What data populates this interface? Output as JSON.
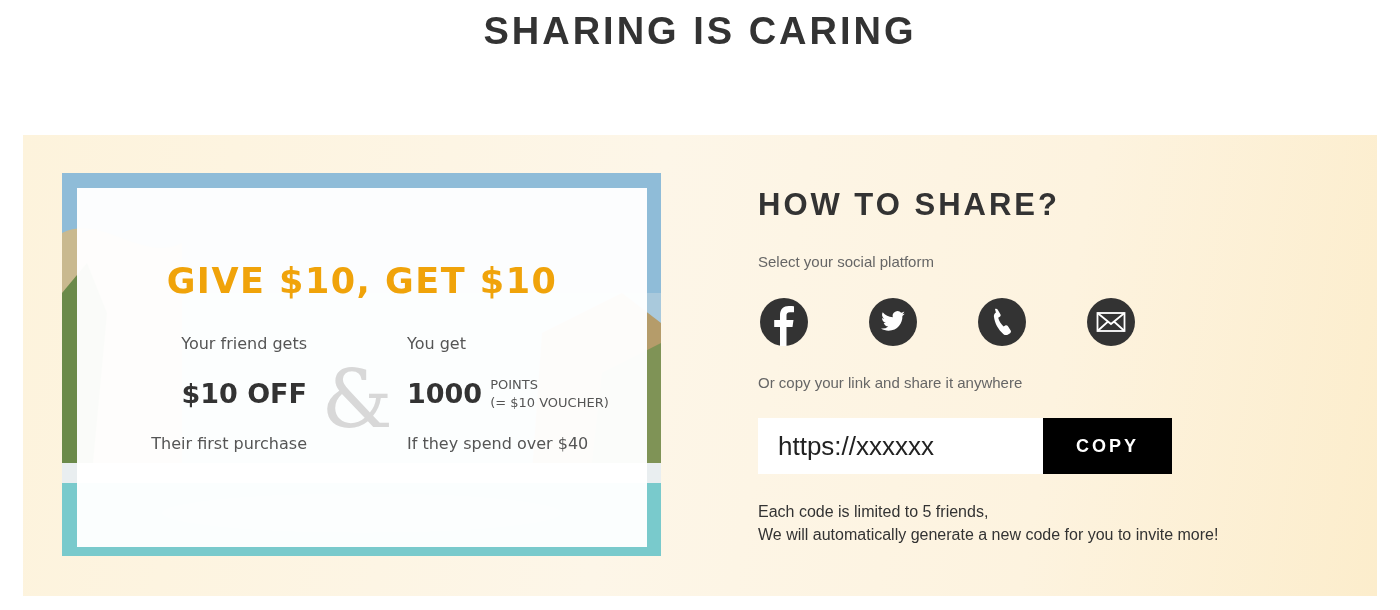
{
  "page_title": "SHARING IS CARING",
  "offer": {
    "kind": "picture",
    "headline": "GIVE $10, GET $10",
    "friend": {
      "label": "Your friend gets",
      "amount": "$10 OFF",
      "note": "Their first purchase"
    },
    "joiner": "&",
    "you": {
      "label": "You get",
      "amount": "1000",
      "unit": "POINTS",
      "unit_note": "(= $10 VOUCHER)",
      "note": "If they spend over $40"
    }
  },
  "share": {
    "heading": "HOW TO SHARE?",
    "platform_prompt": "Select your social platform",
    "platforms": [
      {
        "kind": "facebook"
      },
      {
        "kind": "twitter"
      },
      {
        "kind": "phone"
      },
      {
        "kind": "email"
      }
    ],
    "copy_prompt": "Or copy your link and share it anywhere",
    "link": {
      "value": "https://xxxxxx"
    },
    "copy_button": "COPY",
    "notes": [
      "Each code is limited to 5 friends,",
      "We will automatically generate a new code for you to invite more!"
    ]
  }
}
